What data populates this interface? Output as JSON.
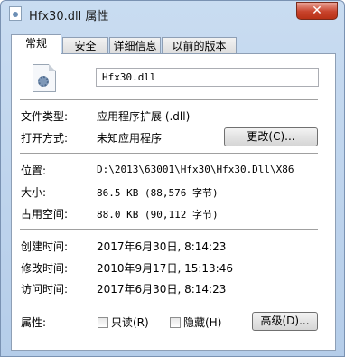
{
  "window": {
    "title": "Hfx30.dll 属性",
    "close_label": "✕"
  },
  "tabs": [
    {
      "label": "常规",
      "active": true
    },
    {
      "label": "安全",
      "active": false
    },
    {
      "label": "详细信息",
      "active": false
    },
    {
      "label": "以前的版本",
      "active": false
    }
  ],
  "file": {
    "icon": "dll-gear-icon",
    "name": "Hfx30.dll"
  },
  "type_section": {
    "file_type_label": "文件类型:",
    "file_type_value": "应用程序扩展 (.dll)",
    "open_with_label": "打开方式:",
    "open_with_value": "未知应用程序",
    "change_button": "更改(C)..."
  },
  "location_section": {
    "location_label": "位置:",
    "location_value": "D:\\2013\\63001\\Hfx30\\Hfx30.Dll\\X86",
    "size_label": "大小:",
    "size_value": "86.5 KB (88,576 字节)",
    "size_on_disk_label": "占用空间:",
    "size_on_disk_value": "88.0 KB (90,112 字节)"
  },
  "dates_section": {
    "created_label": "创建时间:",
    "created_value": "2017年6月30日, 8:14:23",
    "modified_label": "修改时间:",
    "modified_value": "2010年9月17日, 15:13:46",
    "accessed_label": "访问时间:",
    "accessed_value": "2017年6月30日, 8:14:23"
  },
  "attributes": {
    "label": "属性:",
    "readonly_label": "只读(R)",
    "readonly_checked": false,
    "hidden_label": "隐藏(H)",
    "hidden_checked": false,
    "advanced_button": "高级(D)..."
  }
}
